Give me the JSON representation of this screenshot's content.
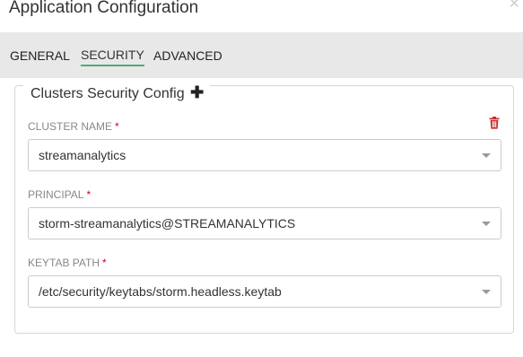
{
  "dialog": {
    "title": "Application Configuration",
    "close_icon": "close-icon"
  },
  "tabs": [
    {
      "label": "GENERAL",
      "active": false
    },
    {
      "label": "SECURITY",
      "active": true
    },
    {
      "label": "ADVANCED",
      "active": false
    }
  ],
  "cluster_config": {
    "legend": "Clusters Security Config",
    "add_icon": "plus-icon",
    "delete_icon": "trash-icon",
    "delete_icon_color": "#c9302c",
    "fields": [
      {
        "label": "CLUSTER NAME",
        "required_mark": "*",
        "value": "streamanalytics"
      },
      {
        "label": "PRINCIPAL",
        "required_mark": "*",
        "value": "storm-streamanalytics@STREAMANALYTICS"
      },
      {
        "label": "KEYTAB PATH",
        "required_mark": "*",
        "value": "/etc/security/keytabs/storm.headless.keytab"
      }
    ]
  },
  "colors": {
    "tabbar_bg": "#e8e8e8",
    "active_tab_underline": "#4caf7d",
    "required_asterisk": "#d0021b"
  }
}
